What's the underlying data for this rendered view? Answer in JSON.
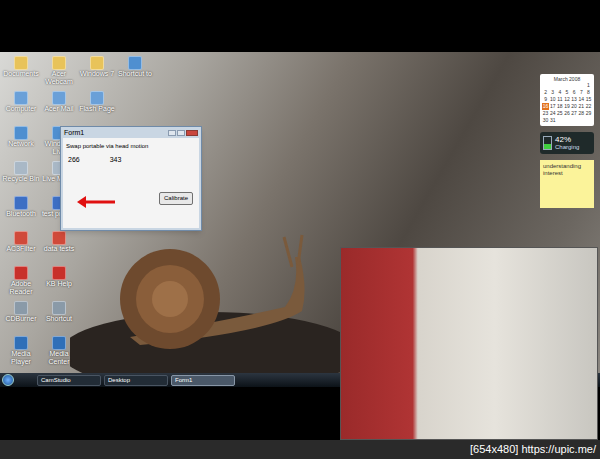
{
  "desktop_icons": [
    {
      "label": "Documents"
    },
    {
      "label": "Computer"
    },
    {
      "label": "Network"
    },
    {
      "label": "Recycle Bin"
    },
    {
      "label": "Bluetooth"
    },
    {
      "label": "AC3Filter"
    },
    {
      "label": "Adobe Reader"
    },
    {
      "label": "CDBurner"
    },
    {
      "label": "Media Player"
    },
    {
      "label": "Acer Webcam"
    },
    {
      "label": "Acer Mail"
    },
    {
      "label": "Windows Live"
    },
    {
      "label": "Live Mess."
    },
    {
      "label": "test project"
    },
    {
      "label": "data tests"
    },
    {
      "label": "KB Help"
    },
    {
      "label": "Shortcut"
    },
    {
      "label": "Media Center"
    },
    {
      "label": "Windows 7"
    },
    {
      "label": "Flash Page"
    },
    {
      "label": "Shortcut to"
    }
  ],
  "window": {
    "title": "Form1",
    "message": "Swap portable via head motion",
    "values": [
      "266",
      "343"
    ],
    "button": "Calibrate"
  },
  "gadgets": {
    "calendar": {
      "title": "March 2008",
      "days": [
        {
          "day": "1",
          "selected": false
        },
        {
          "day": "2",
          "selected": false
        },
        {
          "day": "3",
          "selected": false
        },
        {
          "day": "4",
          "selected": false
        },
        {
          "day": "5",
          "selected": false
        },
        {
          "day": "6",
          "selected": false
        },
        {
          "day": "7",
          "selected": false
        },
        {
          "day": "8",
          "selected": false
        },
        {
          "day": "9",
          "selected": false
        },
        {
          "day": "10",
          "selected": false
        },
        {
          "day": "11",
          "selected": false
        },
        {
          "day": "12",
          "selected": false
        },
        {
          "day": "13",
          "selected": false
        },
        {
          "day": "14",
          "selected": false
        },
        {
          "day": "15",
          "selected": false
        },
        {
          "day": "16",
          "selected": true
        },
        {
          "day": "17",
          "selected": false
        },
        {
          "day": "18",
          "selected": false
        },
        {
          "day": "19",
          "selected": false
        },
        {
          "day": "20",
          "selected": false
        },
        {
          "day": "21",
          "selected": false
        },
        {
          "day": "22",
          "selected": false
        },
        {
          "day": "23",
          "selected": false
        },
        {
          "day": "24",
          "selected": false
        },
        {
          "day": "25",
          "selected": false
        },
        {
          "day": "26",
          "selected": false
        },
        {
          "day": "27",
          "selected": false
        },
        {
          "day": "28",
          "selected": false
        },
        {
          "day": "29",
          "selected": false
        },
        {
          "day": "30",
          "selected": false
        },
        {
          "day": "31",
          "selected": false
        }
      ]
    },
    "battery": {
      "percent": "42%",
      "status": "Charging",
      "level": 0.42
    },
    "note": {
      "text": "understanding interest"
    }
  },
  "taskbar": {
    "items": [
      {
        "label": "CamStudio",
        "selected": false
      },
      {
        "label": "Desktop",
        "selected": false
      },
      {
        "label": "Form1",
        "selected": true
      }
    ]
  },
  "caption": "[654x480] https://upic.me/"
}
